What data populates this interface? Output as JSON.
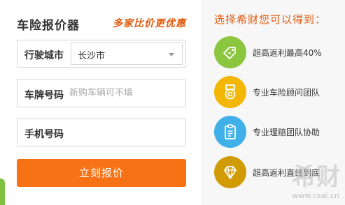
{
  "form": {
    "title": "车险报价器",
    "slogan": "多家比价更优惠",
    "city": {
      "label": "行驶城市",
      "value": "长沙市"
    },
    "plate": {
      "label": "车牌号码",
      "placeholder": "新购车辆可不填"
    },
    "phone": {
      "label": "手机号码",
      "placeholder": ""
    },
    "submit_label": "立刻报价"
  },
  "benefits": {
    "title": "选择希财您可以得到：",
    "items": [
      {
        "text": "超高返利最高40%",
        "icon": "tag-icon",
        "color": "#8cc63f"
      },
      {
        "text": "专业车险顾问团队",
        "icon": "medal-icon",
        "color": "#f2b705"
      },
      {
        "text": "专业理赔团队协助",
        "icon": "clipboard-icon",
        "color": "#3fb0e8"
      },
      {
        "text": "超高返利直线到底",
        "icon": "diamond-icon",
        "color": "#d19b05"
      }
    ]
  },
  "watermark": {
    "text": "希财",
    "sub": "www.csai.cn"
  },
  "colors": {
    "accent": "#e05a0c",
    "button": "#f77214",
    "brand_green": "#7dc243"
  }
}
